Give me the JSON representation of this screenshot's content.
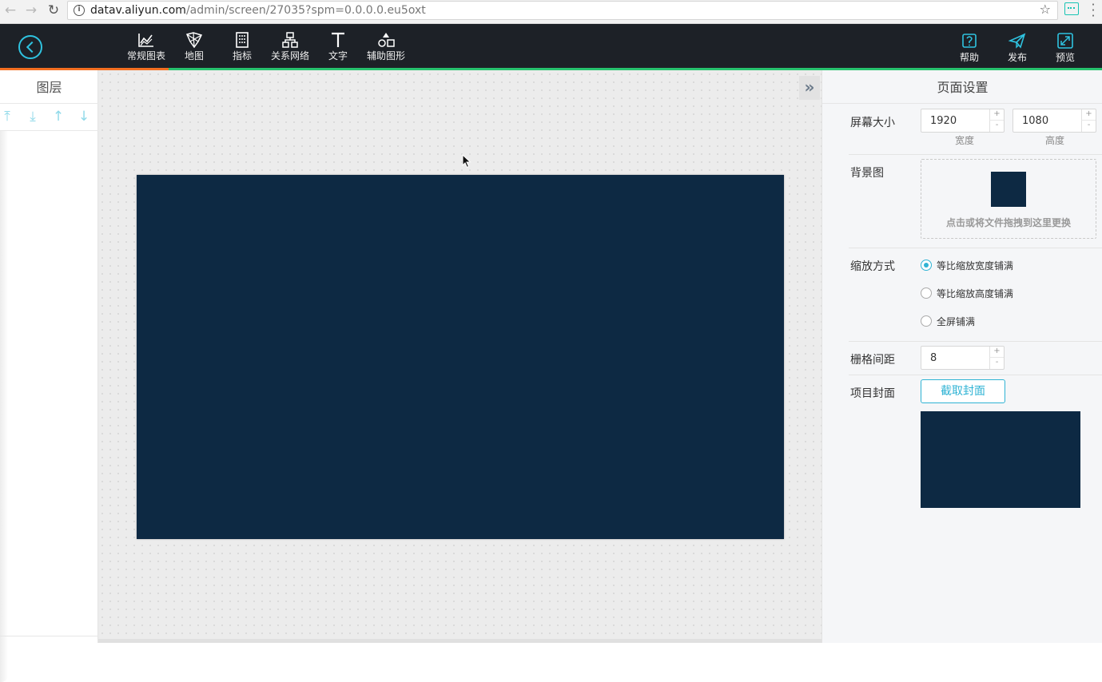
{
  "browser": {
    "url_host": "datav.aliyun.com",
    "url_path": "/admin/screen/27035?spm=0.0.0.0.eu5oxt"
  },
  "toolbar": {
    "items": [
      {
        "label": "常规图表",
        "icon": "chart-icon"
      },
      {
        "label": "地图",
        "icon": "map-icon"
      },
      {
        "label": "指标",
        "icon": "indicator-icon"
      },
      {
        "label": "关系网络",
        "icon": "network-icon"
      },
      {
        "label": "文字",
        "icon": "text-icon"
      },
      {
        "label": "辅助图形",
        "icon": "shapes-icon"
      }
    ],
    "right_items": [
      {
        "label": "帮助",
        "icon": "help-icon"
      },
      {
        "label": "发布",
        "icon": "publish-icon"
      },
      {
        "label": "预览",
        "icon": "preview-icon"
      }
    ],
    "accent_color": "#2fc3e0"
  },
  "layers": {
    "title": "图层"
  },
  "settings": {
    "title": "页面设置",
    "screen_size": {
      "label": "屏幕大小",
      "width": "1920",
      "width_label": "宽度",
      "height": "1080",
      "height_label": "高度"
    },
    "background": {
      "label": "背景图",
      "hint": "点击或将文件拖拽到这里更换",
      "color": "#0d2943"
    },
    "scale": {
      "label": "缩放方式",
      "options": [
        "等比缩放宽度铺满",
        "等比缩放高度铺满",
        "全屏铺满"
      ],
      "selected": "等比缩放宽度铺满"
    },
    "grid": {
      "label": "栅格间距",
      "value": "8"
    },
    "cover": {
      "label": "项目封面",
      "button": "截取封面"
    },
    "stepper_plus": "+",
    "stepper_minus": "-"
  }
}
